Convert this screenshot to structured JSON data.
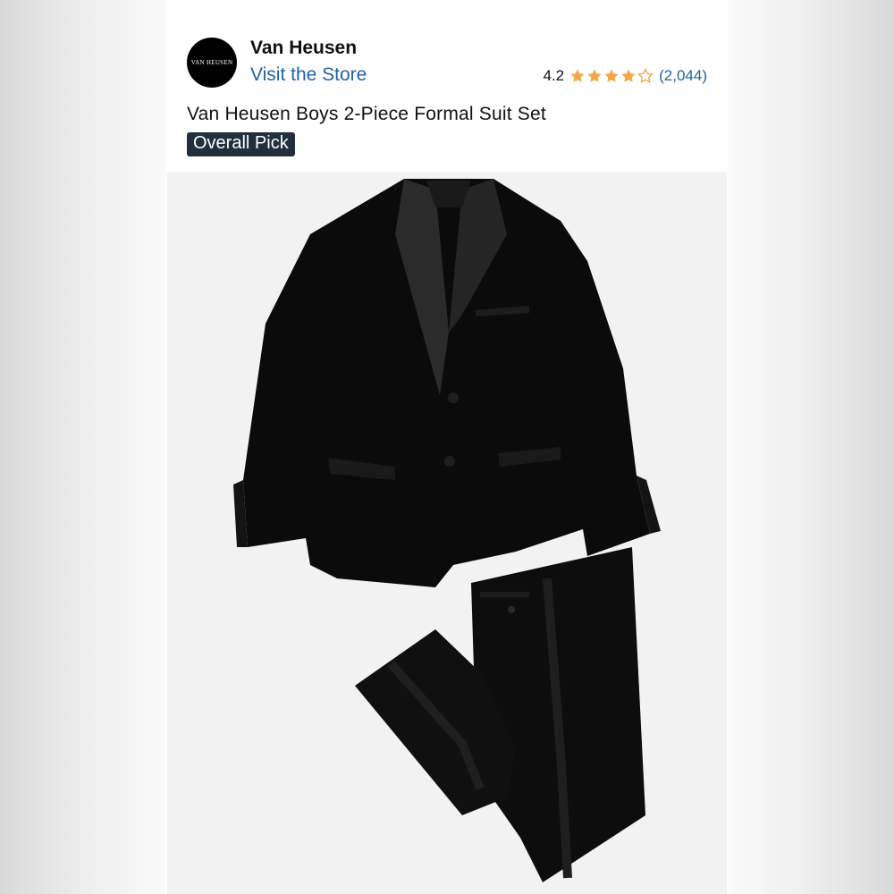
{
  "brand": {
    "logo_text": "VAN HEUSEN",
    "name": "Van Heusen",
    "store_link": "Visit the Store"
  },
  "rating": {
    "value": "4.2",
    "stars": 4.2,
    "max_stars": 5,
    "count": "(2,044)",
    "star_color": "#f3a847"
  },
  "product": {
    "title": "Van Heusen Boys 2-Piece Formal Suit Set",
    "badge": "Overall Pick"
  },
  "colors": {
    "link": "#2162a1",
    "badge_bg": "#232f3e",
    "text": "#0f1111"
  }
}
